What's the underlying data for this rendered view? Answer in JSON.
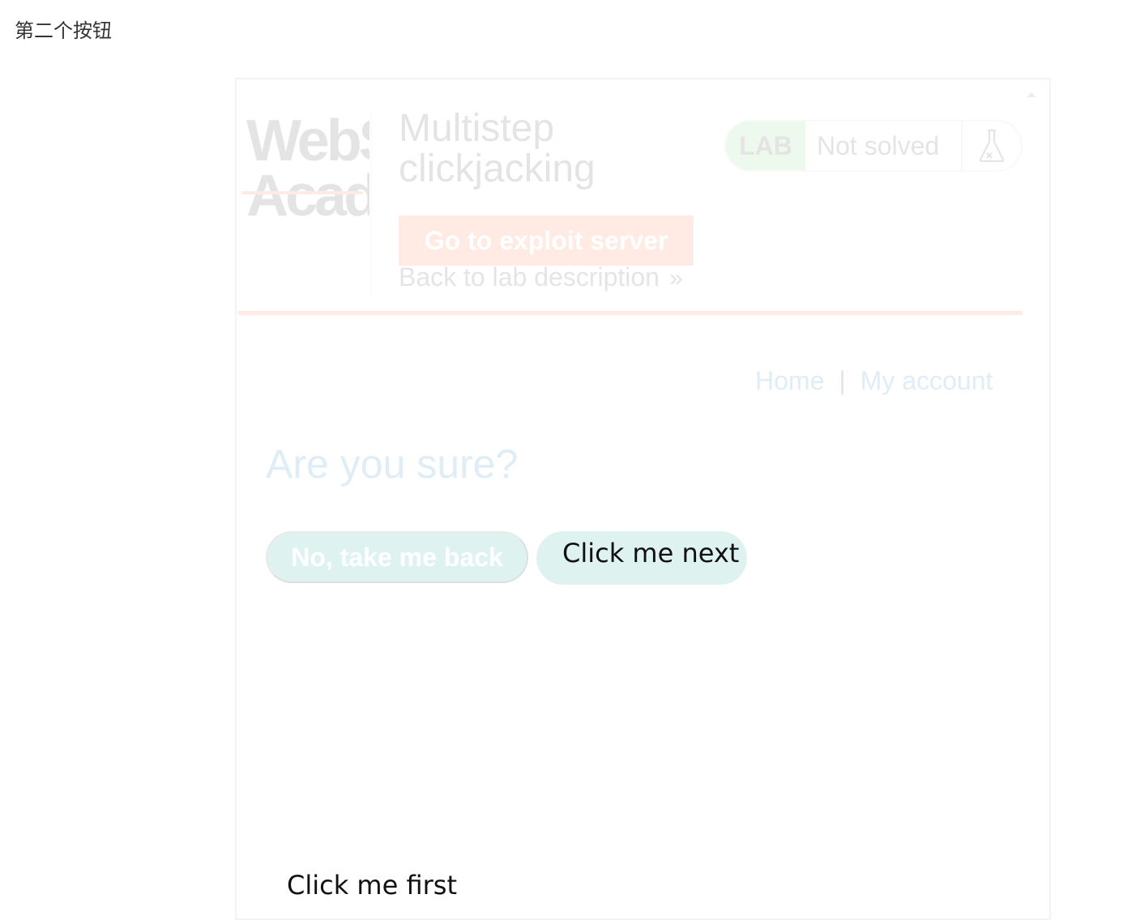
{
  "page": {
    "caption": "第二个按钮"
  },
  "decoy": {
    "first_label": "Click me first",
    "next_label": "Click me next"
  },
  "lab": {
    "logo_line1": "WebSecurity",
    "logo_line2": "Academy",
    "title": "Multistep clickjacking",
    "status_tag": "LAB",
    "status_text": "Not solved",
    "status_icon": "flask-icon",
    "exploit_button": "Go to exploit server",
    "back_link": "Back to lab description",
    "back_link_icon": "double-chevron-right-icon",
    "nav": {
      "home": "Home",
      "separator": "|",
      "my_account": "My account"
    },
    "question": "Are you sure?",
    "no_button": "No, take me back"
  },
  "colors": {
    "accent_orange": "#ff6633",
    "link_blue": "#0071bc",
    "button_teal": "#00a08a",
    "status_green": "#70d16d",
    "decoy_text": "#111111"
  }
}
